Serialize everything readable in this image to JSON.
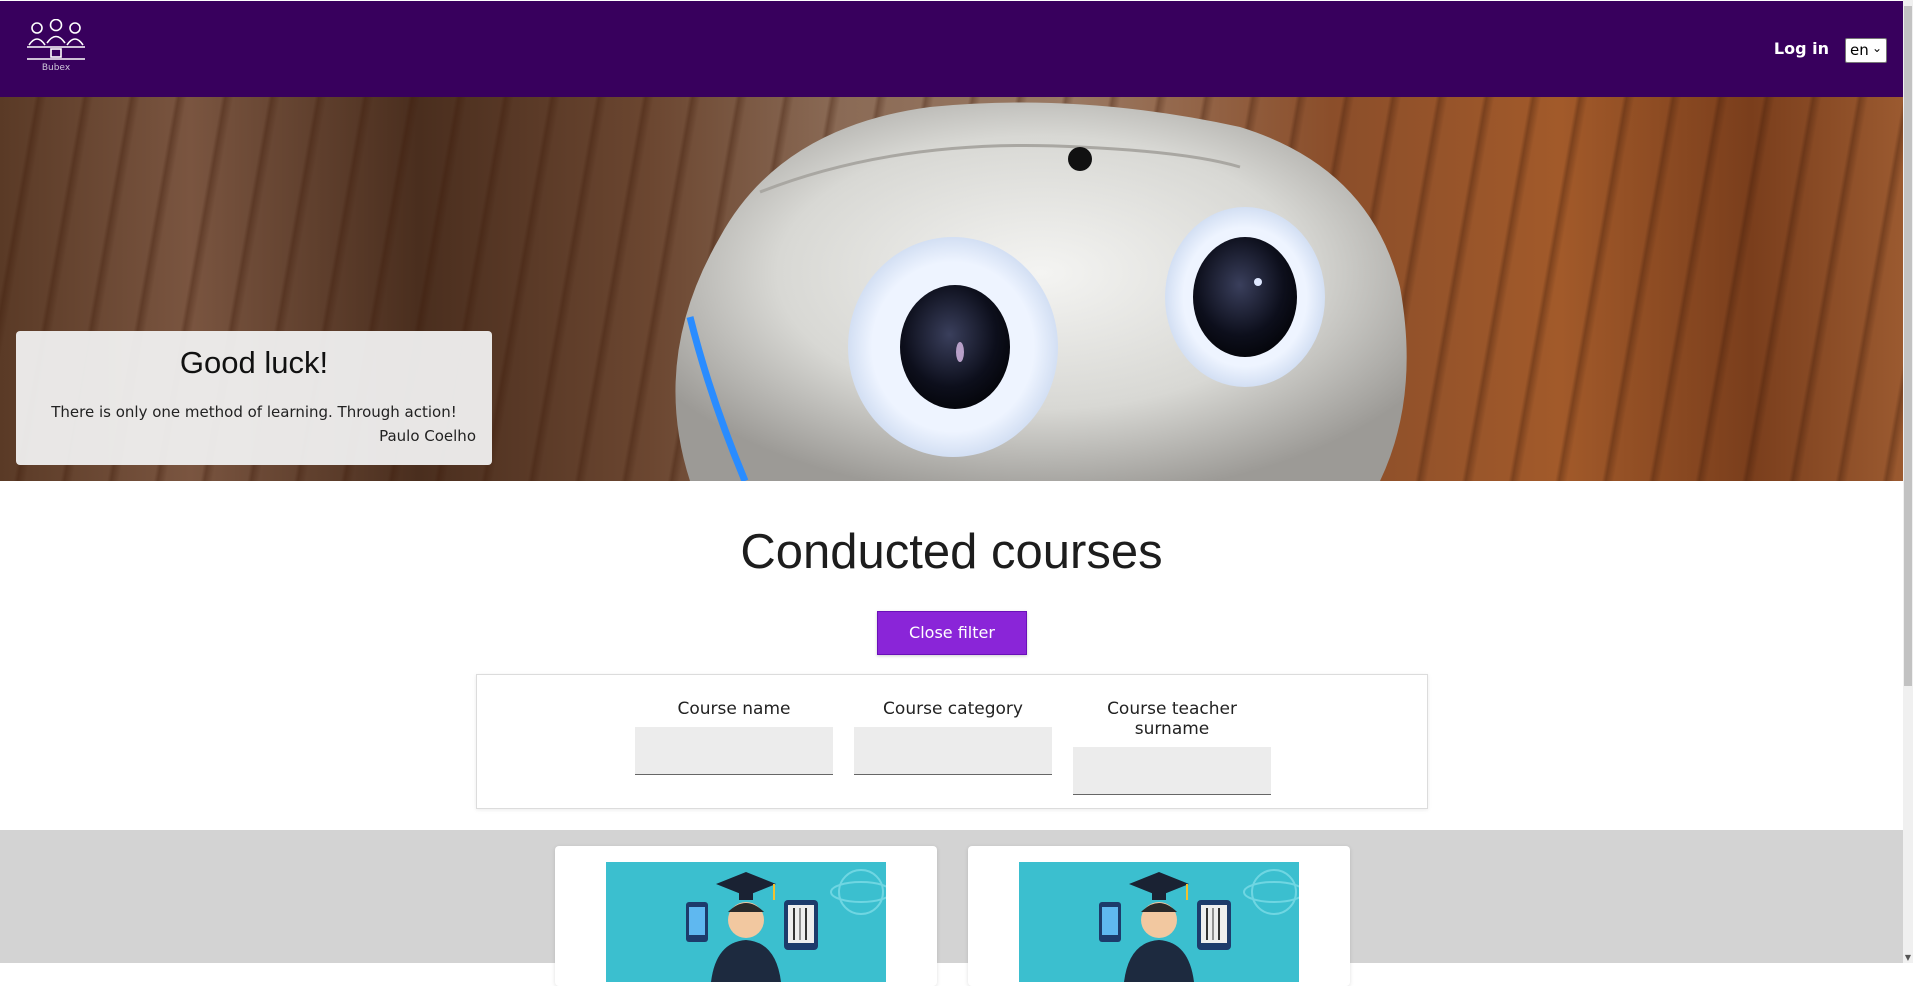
{
  "navbar": {
    "logo_text": "Bubex",
    "login_label": "Log in",
    "language_selected": "en",
    "background_color": "#38005d"
  },
  "hero": {
    "quote_title": "Good luck!",
    "quote_text": "There is only one method of learning. Through action!",
    "quote_author": "Paulo Coelho"
  },
  "main": {
    "title": "Conducted courses",
    "filter_button_label": "Close filter",
    "accent_color": "#8a25d8",
    "filters": [
      {
        "label": "Course name",
        "value": ""
      },
      {
        "label": "Course category",
        "value": ""
      },
      {
        "label": "Course teacher surname",
        "value": ""
      }
    ]
  },
  "courses": [
    {
      "image_icon": "graduate-illustration"
    },
    {
      "image_icon": "graduate-illustration"
    }
  ]
}
